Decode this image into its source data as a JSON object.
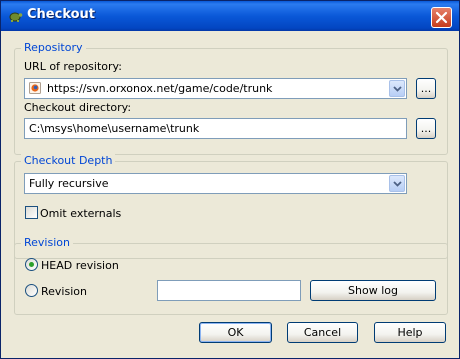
{
  "window": {
    "title": "Checkout"
  },
  "repository": {
    "legend": "Repository",
    "url_label": "URL of repository:",
    "url_value": "https://svn.orxonox.net/game/code/trunk",
    "dir_label": "Checkout directory:",
    "dir_value": "C:\\msys\\home\\username\\trunk",
    "browse_label": "..."
  },
  "depth": {
    "legend": "Checkout Depth",
    "value": "Fully recursive",
    "omit_externals_label": "Omit externals",
    "omit_externals_checked": false
  },
  "revision": {
    "legend": "Revision",
    "head_label": "HEAD revision",
    "revision_label": "Revision",
    "revision_value": "",
    "selected": "head",
    "show_log_label": "Show log"
  },
  "buttons": {
    "ok": "OK",
    "cancel": "Cancel",
    "help": "Help"
  },
  "colors": {
    "legend": "#0046d5",
    "titlebar": "#0a58d8",
    "face": "#ece9d8"
  }
}
